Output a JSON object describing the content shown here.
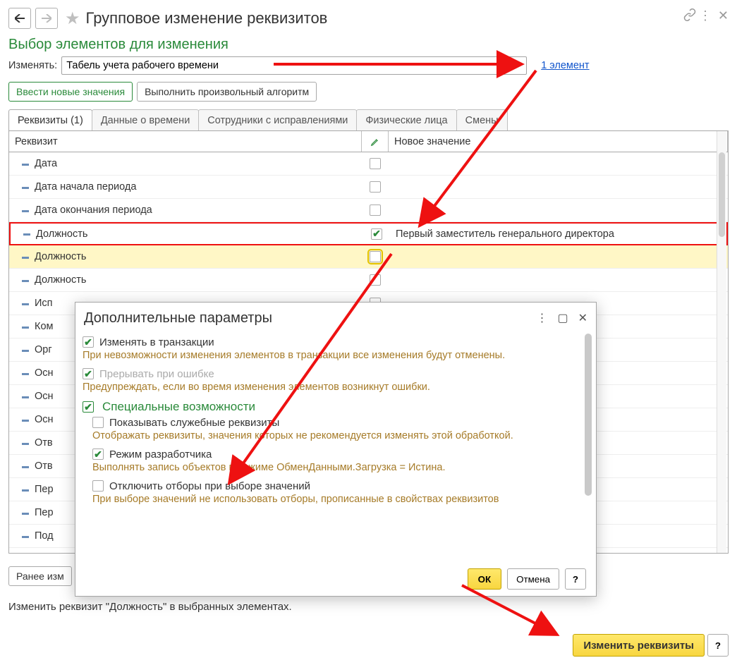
{
  "header": {
    "title": "Групповое изменение реквизитов",
    "section": "Выбор элементов для изменения",
    "change_label": "Изменять:",
    "change_value": "Табель учета рабочего времени",
    "elements_link": "1 элемент"
  },
  "action_buttons": {
    "enter_values": "Ввести новые значения",
    "run_algo": "Выполнить произвольный алгоритм"
  },
  "tabs": [
    "Реквизиты (1)",
    "Данные о времени",
    "Сотрудники с исправлениями",
    "Физические лица",
    "Смены"
  ],
  "grid": {
    "col_req": "Реквизит",
    "col_val": "Новое значение",
    "rows": [
      {
        "name": "Дата",
        "checked": false,
        "value": ""
      },
      {
        "name": "Дата начала периода",
        "checked": false,
        "value": ""
      },
      {
        "name": "Дата окончания периода",
        "checked": false,
        "value": ""
      },
      {
        "name": "Должность",
        "checked": true,
        "value": "Первый заместитель генерального директора"
      },
      {
        "name": "Должность",
        "checked": false,
        "value": ""
      },
      {
        "name": "Должность",
        "checked": false,
        "value": ""
      },
      {
        "name": "Исп",
        "checked": false,
        "value": ""
      },
      {
        "name": "Ком",
        "checked": false,
        "value": ""
      },
      {
        "name": "Орг",
        "checked": false,
        "value": ""
      },
      {
        "name": "Осн",
        "checked": false,
        "value": ""
      },
      {
        "name": "Осн",
        "checked": false,
        "value": ""
      },
      {
        "name": "Осн",
        "checked": false,
        "value": ""
      },
      {
        "name": "Отв",
        "checked": false,
        "value": ""
      },
      {
        "name": "Отв",
        "checked": false,
        "value": ""
      },
      {
        "name": "Пер",
        "checked": false,
        "value": ""
      },
      {
        "name": "Пер",
        "checked": false,
        "value": ""
      },
      {
        "name": "Под",
        "checked": false,
        "value": ""
      }
    ]
  },
  "previous_label": "Ранее изм",
  "summary": "Изменить реквизит \"Должность\" в выбранных элементах.",
  "main_action": "Изменить реквизиты",
  "q_mark": "?",
  "dialog": {
    "title": "Дополнительные параметры",
    "opt_transaction": "Изменять в транзакции",
    "hint_transaction": "При невозможности изменения элементов в транзакции все изменения будут отменены.",
    "opt_interrupt": "Прерывать при ошибке",
    "hint_interrupt": "Предупреждать, если во время изменения элементов возникнут ошибки.",
    "opt_special": "Специальные возможности",
    "opt_show_service": "Показывать служебные реквизиты",
    "hint_show_service": "Отображать реквизиты, значения которых не рекомендуется изменять этой обработкой.",
    "opt_dev": "Режим разработчика",
    "hint_dev": "Выполнять запись объектов в режиме ОбменДанными.Загрузка = Истина.",
    "opt_disable_filters": "Отключить отборы при выборе значений",
    "hint_disable_filters": "При выборе значений не использовать отборы, прописанные в свойствах реквизитов",
    "ok": "ОК",
    "cancel": "Отмена",
    "help": "?"
  }
}
